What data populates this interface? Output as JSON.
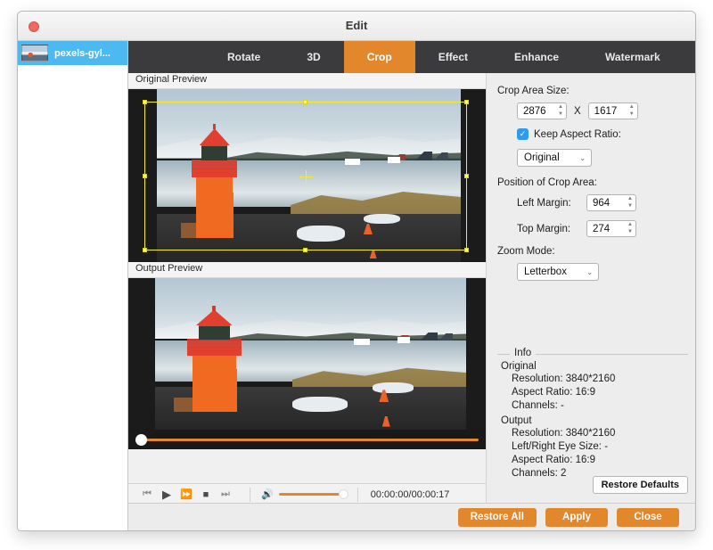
{
  "window": {
    "title": "Edit",
    "close_icon": "close-icon"
  },
  "sidebar": {
    "items": [
      {
        "name": "pexels-gyl...",
        "thumb_icon": "video-thumbnail-icon"
      }
    ]
  },
  "tabs": [
    {
      "label": "Rotate",
      "active": false
    },
    {
      "label": "3D",
      "active": false
    },
    {
      "label": "Crop",
      "active": true
    },
    {
      "label": "Effect",
      "active": false
    },
    {
      "label": "Enhance",
      "active": false
    },
    {
      "label": "Watermark",
      "active": false
    }
  ],
  "previews": {
    "original_label": "Original Preview",
    "output_label": "Output Preview"
  },
  "transport": {
    "prev_icon": "skip-previous-icon",
    "play_icon": "play-icon",
    "forward_icon": "fast-forward-icon",
    "stop_icon": "stop-icon",
    "next_icon": "skip-next-icon",
    "volume_icon": "volume-icon",
    "timecode": "00:00:00/00:00:17"
  },
  "crop_panel": {
    "size_label": "Crop Area Size:",
    "width": "2876",
    "x_separator": "X",
    "height": "1617",
    "keep_ratio_label": "Keep Aspect Ratio:",
    "keep_ratio_checked": true,
    "check_glyph": "✓",
    "ratio_value": "Original",
    "position_label": "Position of Crop Area:",
    "left_margin_label": "Left Margin:",
    "left_margin_value": "964",
    "top_margin_label": "Top Margin:",
    "top_margin_value": "274",
    "zoom_mode_label": "Zoom Mode:",
    "zoom_mode_value": "Letterbox",
    "spin_up": "▲",
    "spin_down": "▼",
    "chevron": "⌄"
  },
  "info": {
    "legend": "Info",
    "original_head": "Original",
    "original_lines": [
      "Resolution: 3840*2160",
      "Aspect Ratio: 16:9",
      "Channels: -"
    ],
    "output_head": "Output",
    "output_lines": [
      "Resolution: 3840*2160",
      "Left/Right Eye Size: -",
      "Aspect Ratio: 16:9",
      "Channels: 2"
    ]
  },
  "buttons": {
    "restore_defaults": "Restore Defaults",
    "restore_all": "Restore All",
    "apply": "Apply",
    "close": "Close"
  },
  "colors": {
    "accent": "#e2872c",
    "tabbar": "#3b3b3d",
    "selection": "#4cb9f0",
    "crop_outline": "#f2ee2a"
  }
}
